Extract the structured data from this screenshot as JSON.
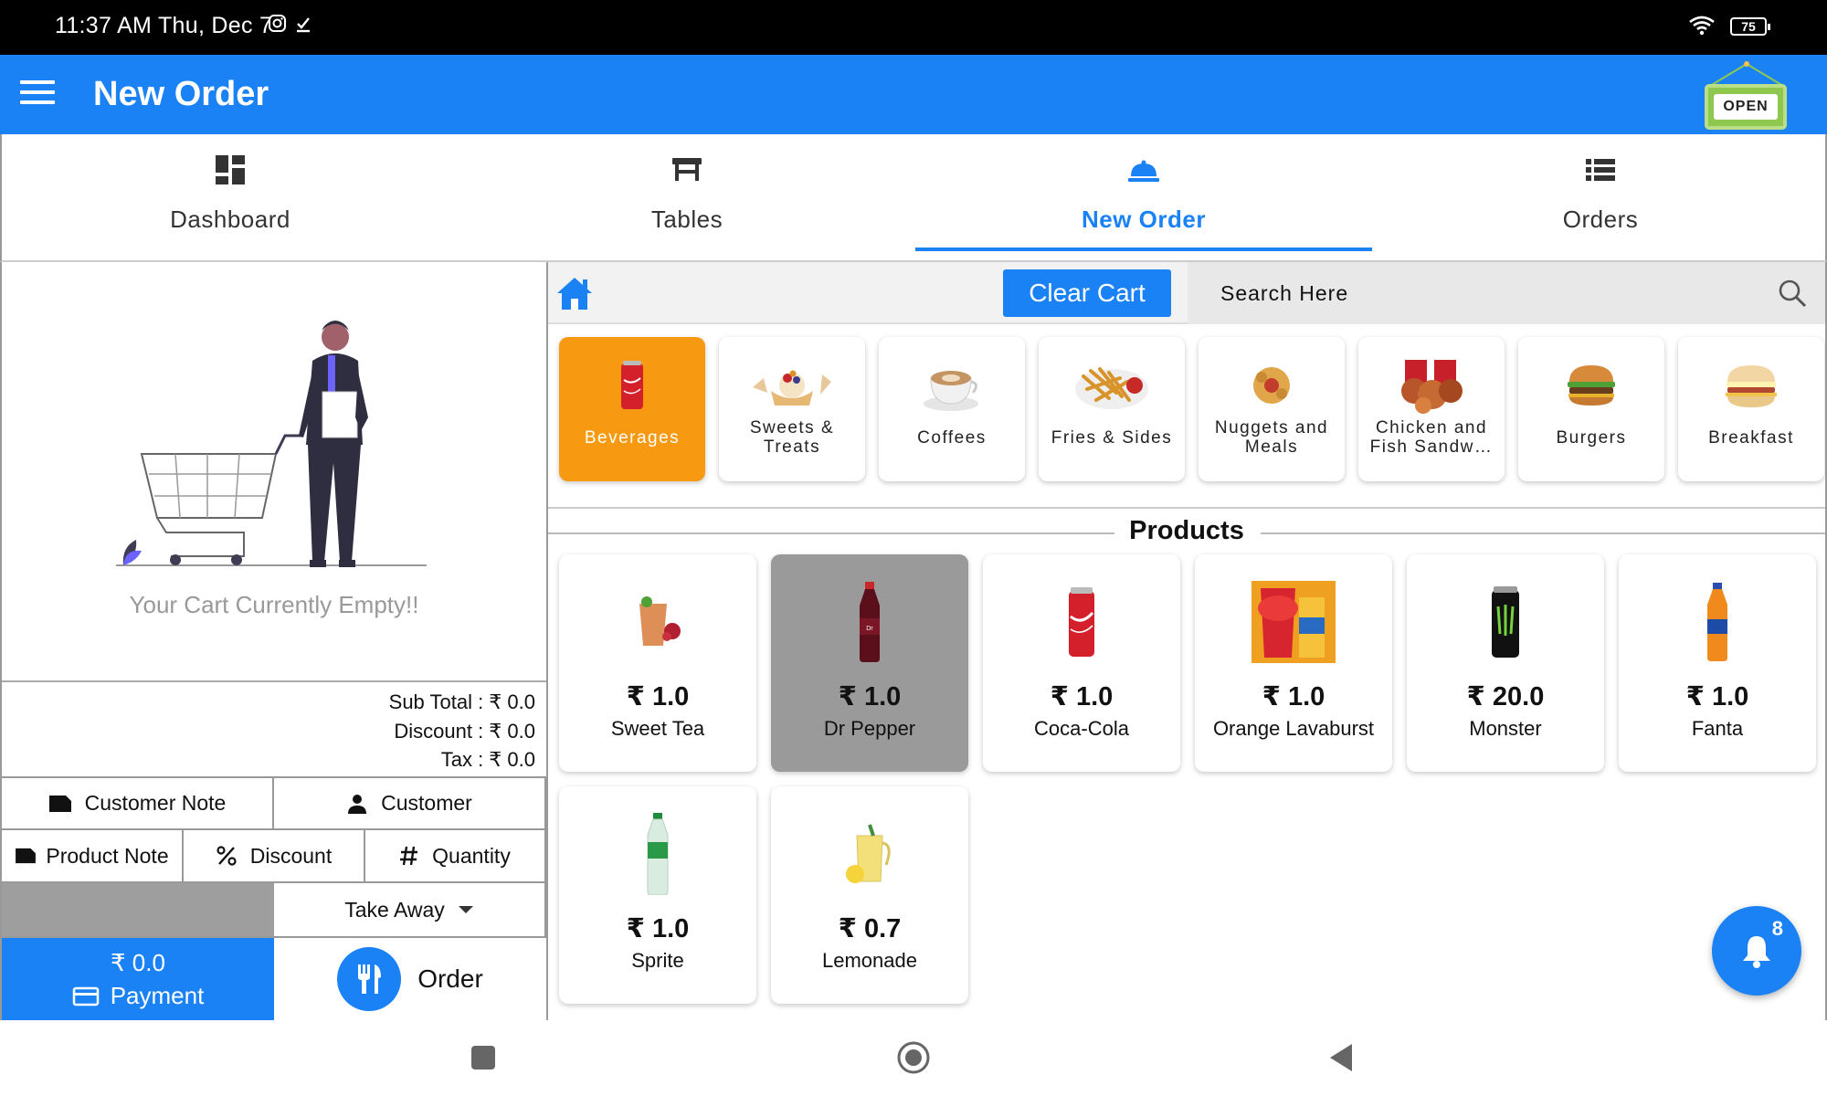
{
  "status_bar": {
    "time": "11:37 AM Thu, Dec 7",
    "battery": "75"
  },
  "app_bar": {
    "title": "New Order",
    "open_sign": "OPEN"
  },
  "tabs": [
    {
      "label": "Dashboard",
      "icon": "dashboard-icon"
    },
    {
      "label": "Tables",
      "icon": "table-icon"
    },
    {
      "label": "New Order",
      "icon": "cloche-icon",
      "active": true
    },
    {
      "label": "Orders",
      "icon": "list-icon"
    }
  ],
  "cart": {
    "empty_message": "Your Cart Currently Empty!!",
    "sub_total": "Sub Total : ₹ 0.0",
    "discount": "Discount : ₹ 0.0",
    "tax": "Tax : ₹ 0.0"
  },
  "actions": {
    "customer_note": "Customer Note",
    "customer": "Customer",
    "product_note": "Product Note",
    "discount": "Discount",
    "quantity": "Quantity",
    "order_type": "Take Away",
    "payment_amount": "₹ 0.0",
    "payment": "Payment",
    "order": "Order"
  },
  "toolbar": {
    "clear_cart": "Clear Cart",
    "search_placeholder": "Search Here"
  },
  "categories": [
    {
      "name": "Beverages",
      "active": true
    },
    {
      "name": "Sweets & Treats"
    },
    {
      "name": "Coffees"
    },
    {
      "name": "Fries & Sides"
    },
    {
      "name": "Nuggets and Meals"
    },
    {
      "name": "Chicken and Fish Sandw…"
    },
    {
      "name": "Burgers"
    },
    {
      "name": "Breakfast"
    }
  ],
  "products_title": "Products",
  "products": [
    {
      "name": "Sweet Tea",
      "price": "₹ 1.0"
    },
    {
      "name": "Dr Pepper",
      "price": "₹ 1.0",
      "selected": true
    },
    {
      "name": "Coca-Cola",
      "price": "₹ 1.0"
    },
    {
      "name": "Orange Lavaburst",
      "price": "₹ 1.0"
    },
    {
      "name": "Monster",
      "price": "₹ 20.0"
    },
    {
      "name": "Fanta",
      "price": "₹ 1.0"
    },
    {
      "name": "Sprite",
      "price": "₹ 1.0"
    },
    {
      "name": "Lemonade",
      "price": "₹ 0.7"
    }
  ],
  "notifications": {
    "count": "8"
  },
  "colors": {
    "primary": "#1a82f4",
    "category_active": "#f79a12",
    "selected_product": "#9a9a9a"
  }
}
